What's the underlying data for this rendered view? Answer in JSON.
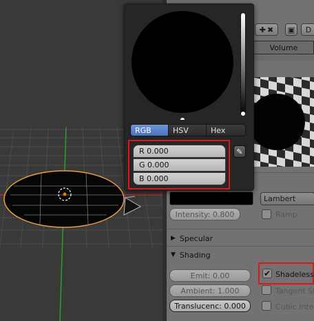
{
  "header": {
    "tab_volume": "Volume",
    "d_button": "D"
  },
  "picker": {
    "tabs": [
      "RGB",
      "HSV",
      "Hex"
    ],
    "active_tab": "RGB",
    "fields": [
      {
        "label": "R 0.000"
      },
      {
        "label": "G 0.000"
      },
      {
        "label": "B 0.000"
      }
    ]
  },
  "diffuse": {
    "shader": "Lambert",
    "intensity": "Intensity: 0.800",
    "ramp": "Ramp"
  },
  "panels": {
    "specular": "Specular",
    "shading": "Shading"
  },
  "shading": {
    "emit": "Emit: 0.00",
    "ambient": "Ambient: 1.000",
    "translucency": "Translucenc: 0.000",
    "shadeless": "Shadeless",
    "shadeless_checked": true,
    "tangent": "Tangent Sha",
    "cubic": "Cubic Interp"
  },
  "colors": {
    "highlight": "#e3131b",
    "active_tab": "#5a82c9",
    "grid_red": "#c03030",
    "grid_green": "#2e9e2e"
  }
}
